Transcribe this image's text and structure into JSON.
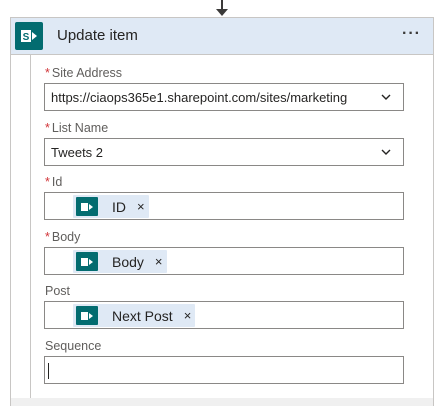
{
  "action": {
    "title": "Update item",
    "menu_label": "···",
    "icon": "sharepoint-icon",
    "brand_color": "#036c70"
  },
  "fields": {
    "site_address": {
      "label": "Site Address",
      "required": true,
      "value": "https://ciaops365e1.sharepoint.com/sites/marketing"
    },
    "list_name": {
      "label": "List Name",
      "required": true,
      "value": "Tweets 2"
    },
    "id": {
      "label": "Id",
      "required": true,
      "token": "ID"
    },
    "body": {
      "label": "Body",
      "required": true,
      "token": "Body"
    },
    "post": {
      "label": "Post",
      "required": false,
      "token": "Next Post"
    },
    "sequence": {
      "label": "Sequence",
      "required": false,
      "value": ""
    }
  },
  "token_remove_glyph": "×",
  "required_mark": "*"
}
